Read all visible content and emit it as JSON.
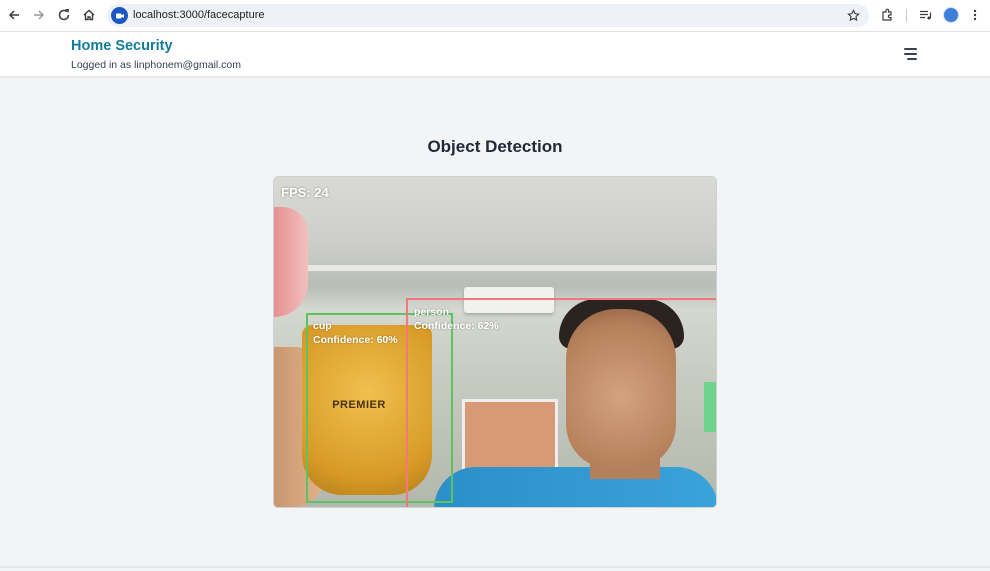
{
  "browser": {
    "url": "localhost:3000/facecapture",
    "icons": [
      "back-icon",
      "forward-icon",
      "reload-icon",
      "home-icon",
      "site-info-icon",
      "bookmark-star-icon",
      "extensions-icon",
      "media-controls-icon",
      "profile-avatar",
      "more-options-icon"
    ]
  },
  "header": {
    "brand": "Home Security",
    "logged_in_text": "Logged in as linphonem@gmail.com",
    "menu_icon": "hamburger-menu-icon"
  },
  "main": {
    "title": "Object Detection",
    "video": {
      "fps_text": "FPS: 24",
      "detections": [
        {
          "label": "cup",
          "confidence_text": "Confidence: 60%",
          "confidence": 0.6,
          "color": "#5cc35f"
        },
        {
          "label": "person",
          "confidence_text": "Confidence: 62%",
          "confidence": 0.62,
          "color": "#f07a7a"
        }
      ],
      "cup_print": "PREMIER"
    }
  },
  "colors": {
    "brand": "#127c99",
    "background": "#f3f4f6"
  }
}
